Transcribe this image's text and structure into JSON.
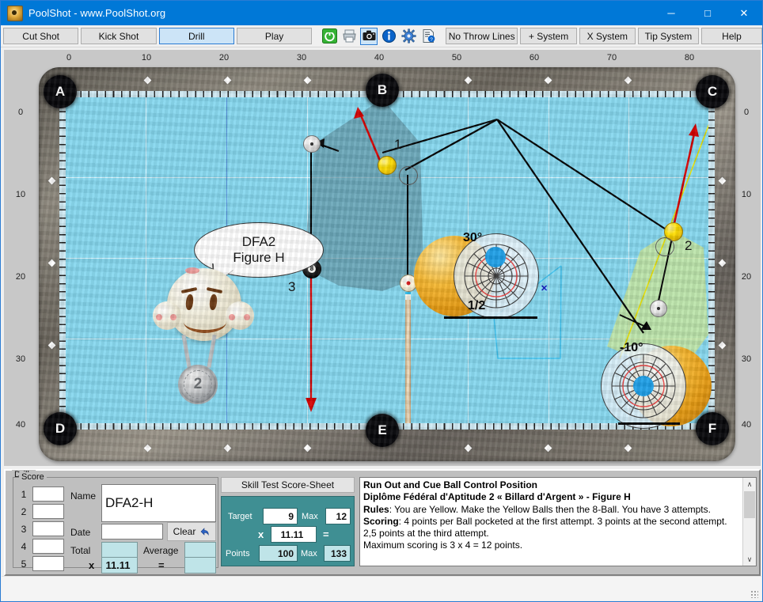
{
  "window": {
    "title": "PoolShot - www.PoolShot.org",
    "icon": "poolshot-logo-icon",
    "minimize": "─",
    "maximize": "□",
    "close": "✕"
  },
  "toolbar": {
    "tabs": [
      {
        "label": "Cut Shot",
        "selected": false
      },
      {
        "label": "Kick Shot",
        "selected": false
      },
      {
        "label": "Drill",
        "selected": true
      },
      {
        "label": "Play",
        "selected": false
      }
    ],
    "icons": [
      {
        "name": "power-icon",
        "selected": false
      },
      {
        "name": "printer-icon",
        "selected": false
      },
      {
        "name": "camera-icon",
        "selected": true
      },
      {
        "name": "info-icon",
        "selected": false
      },
      {
        "name": "gear-icon",
        "selected": false
      },
      {
        "name": "document-help-icon",
        "selected": false
      }
    ],
    "buttons": [
      {
        "label": "No Throw Lines"
      },
      {
        "label": "+ System"
      },
      {
        "label": "X System"
      },
      {
        "label": "Tip System"
      },
      {
        "label": "Help"
      }
    ]
  },
  "table": {
    "top_axis": [
      "0",
      "10",
      "20",
      "30",
      "40",
      "50",
      "60",
      "70",
      "80"
    ],
    "left_axis": [
      "0",
      "10",
      "20",
      "30",
      "40"
    ],
    "right_axis": [
      "0",
      "10",
      "20",
      "30",
      "40"
    ],
    "pockets": [
      {
        "label": "A",
        "pos": "top-left"
      },
      {
        "label": "B",
        "pos": "top-center"
      },
      {
        "label": "C",
        "pos": "top-right"
      },
      {
        "label": "D",
        "pos": "bottom-left"
      },
      {
        "label": "E",
        "pos": "bottom-center"
      },
      {
        "label": "F",
        "pos": "bottom-right"
      }
    ],
    "shot_numbers": [
      "1",
      "2",
      "3"
    ],
    "aim_ball_top": {
      "angle_label": "30°",
      "fraction_label": "1/2"
    },
    "aim_ball_bottom": {
      "angle_label": "-10°"
    },
    "eight_ball_label": "8",
    "mascot": {
      "bubble_line1": "DFA2",
      "bubble_line2": "Figure H",
      "medal_label": "2"
    },
    "colors": {
      "cloth": "#86d8ef",
      "rail": "#cfe9f2",
      "shot_line": "#d40000",
      "ghost_line": "#000000",
      "cone_top": "#5d8f9e",
      "cone_bottom": "#c9e79a",
      "aim_line": "#e8e000",
      "helper_line": "#39c0ef"
    }
  },
  "score_panel": {
    "drills_group_label": "Drills",
    "score_group_label": "Score",
    "row_numbers": [
      "1",
      "2",
      "3",
      "4",
      "5"
    ],
    "row_values": [
      "",
      "",
      "",
      "",
      ""
    ],
    "name_label": "Name",
    "name_value": "DFA2-H",
    "date_label": "Date",
    "date_value": "",
    "clear_label": "Clear",
    "clear_icon": "undo-arrow-icon",
    "total_label": "Total",
    "total_value": "",
    "average_label": "Average",
    "average_value": "",
    "multiply_symbol": "x",
    "multiplier_value": "11.11",
    "equals_symbol": "=",
    "result_value": ""
  },
  "skill_panel": {
    "header": "Skill Test Score-Sheet",
    "target_label": "Target",
    "target_value": "9",
    "target_max_label": "Max",
    "target_max_value": "12",
    "multiply_symbol": "x",
    "factor_value": "11.11",
    "equals_symbol": "=",
    "points_label": "Points",
    "points_value": "100",
    "points_max_label": "Max",
    "points_max_value": "133"
  },
  "rules_panel": {
    "title": "Run Out and Cue Ball Control Position",
    "subtitle": "Diplôme Fédéral d'Aptitude 2 « Billard d'Argent » - Figure H",
    "rules_label": "Rules",
    "rules_text": ": You are Yellow. Make the Yellow Balls then the 8-Ball. You have 3 attempts.",
    "scoring_label": "Scoring",
    "scoring_text": ": 4 points per Ball pocketed at the first attempt. 3 points at the second attempt. 2,5 points at the third attempt.",
    "max_text": "Maximum scoring is 3 x 4 = 12 points.",
    "scroll_up": "∧",
    "scroll_down": "∨"
  },
  "statusbar": {
    "text": ""
  }
}
